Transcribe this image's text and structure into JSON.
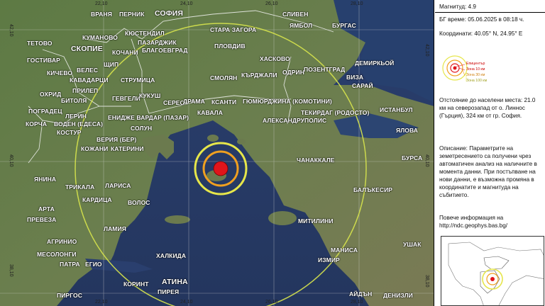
{
  "map": {
    "coords_top": [
      "22,10",
      "24,10",
      "26,10",
      "28,10"
    ],
    "coords_bottom": [
      "22,10",
      "24,10",
      "26,10",
      "28,10"
    ],
    "coords_left": [
      "42,10",
      "40,10",
      "38,10"
    ],
    "coords_right": [
      "42,10",
      "40,10",
      "38,10"
    ],
    "cities": {
      "sofia": "СОФИЯ",
      "vranya": "ВРАНЯ",
      "pernik": "ПЕРНИК",
      "sliven": "СЛИВЕН",
      "yambol": "ЯМБОЛ",
      "burgas": "БУРГАС",
      "kyustendil": "КЮСТЕНДИЛ",
      "kumanovo": "КУМАНОВО",
      "stara_zagora": "СТАРА ЗАГОРА",
      "tetovo": "ТЕТОВО",
      "skopje": "СКОПИЕ",
      "kochani": "КОЧАНИ",
      "pazardzhik": "ПАЗАРДЖИК",
      "blagoevgrad": "БЛАГОЕВГРАД",
      "plovdiv": "ПЛОВДИВ",
      "haskovo": "ХАСКОВО",
      "gostivar": "ГОСТИВАР",
      "veles": "ВЕЛЕС",
      "shtip": "ЩИП",
      "kichevo": "КИЧЕВО",
      "kavadarci": "КАВАДАРЦИ",
      "strumica": "СТРУМИЦА",
      "smolyan": "СМОЛЯН",
      "kardzhali": "КЪРДЖАЛИ",
      "odrin": "ОДРИН",
      "pozentgrad": "ПОЗЕНТГРАД",
      "demirkoy": "ДЕМИРКЬОЙ",
      "ohrid": "ОХРИД",
      "prilep": "ПРИЛЕП",
      "viza": "ВИЗА",
      "saray": "САРАЙ",
      "pogradec": "ПОГРАДЕЦ",
      "bitola": "БИТОЛЯ",
      "gevgeli": "ГЕВГЕЛИ",
      "kukush": "КУКУШ",
      "seres": "СЕРЕС",
      "drama": "ДРАМА",
      "ksanti": "КСАНТИ",
      "gyumyurdzhina": "ГЮМЮРДЖИНА (КОМОТИНИ)",
      "florina": "ЛЕРИН",
      "enidzhe": "ЕНИДЖЕ ВАРДАР (ПАЗАР)",
      "kavala": "КАВАЛА",
      "tekirdag": "ТЕКИРДАГ (РОДОСТО)",
      "istanbul": "ИСТАНБУЛ",
      "korcha": "КОРЧА",
      "voden": "ВОДЕН (ЕДЕСА)",
      "solun": "СОЛУН",
      "aleksandrupolis": "АЛЕКСАНДРУПОЛИС",
      "kostur": "КОСТУР",
      "veria": "ВЕРИЯ (БЕР)",
      "yalova": "ЯЛОВА",
      "kozhani": "КОЖАНИ",
      "katerini": "КАТЕРИНИ",
      "chanakkale": "ЧАНАККАЛЕ",
      "bursa": "БУРСА",
      "yanina": "ЯНИНА",
      "trikala": "ТРИКАЛА",
      "larisa": "ЛАРИСА",
      "balikesir": "БАЛЪКЕСИР",
      "karditsa": "КАРДИЦА",
      "arta": "АРТА",
      "volos": "ВОЛОС",
      "preveza": "ПРЕВЕЗА",
      "lamia": "ЛАМИЯ",
      "mitilini": "МИТИЛИНИ",
      "agrinio": "АГРИНИО",
      "halkida": "ХАЛКИДА",
      "manisa": "МАНИСА",
      "usak": "УШАК",
      "mesolongi": "МЕСОЛОНГИ",
      "patra": "ПАТРА",
      "egio": "ЕГИО",
      "izmir": "ИЗМИР",
      "atina": "АТИНА",
      "pirgos": "ПИРГОС",
      "korint": "КОРИНТ",
      "pirea": "ПИРЕЯ",
      "aydin": "АЙДЪН",
      "denizli": "ДЕНИЗЛИ"
    }
  },
  "panel": {
    "magnitude": "Магнитуд: 4.9",
    "bg_time": "БГ време: 05.06.2025 в 08:18 ч.",
    "coordinates": "Координати: 40.05° N, 24.95° E",
    "legend": {
      "epicenter": "Епицентър",
      "zone10": "Зона 10 км",
      "zone30": "Зона 30 км",
      "zone100": "Зона 100 км"
    },
    "distance": "Отстояние до населени места: 21.0 км на северозапад от о. Линнос (Гърция), 324 км от гр. София.",
    "description": "Описание: Параметрите на земетресението са получени чрез автоматичен анализ на наличните в момента данни. При постъпване на нови данни, е възможна промяна в координатите и магнитуда на събитието.",
    "more_info": "Повече информация на http://ndc.geophys.bas.bg/"
  },
  "colors": {
    "epicenter": "#e0151b",
    "zone10": "#e0151b",
    "zone30": "#f0a020",
    "zone100": "#e8e84a",
    "sea": "#2c3f66",
    "land": "#4a6a3c"
  }
}
